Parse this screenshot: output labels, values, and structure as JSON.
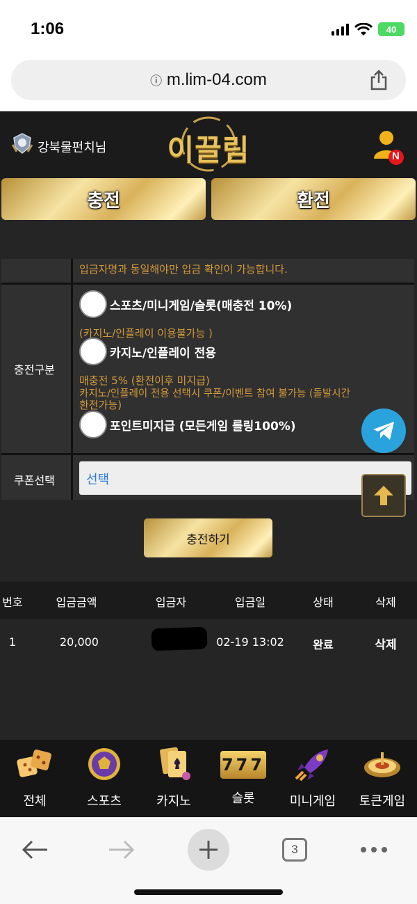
{
  "status_bar": {
    "time": "1:06",
    "battery": "40"
  },
  "browser": {
    "url": "m.lim-04.com",
    "tab_count": "3"
  },
  "header": {
    "username": "강북물펀치님",
    "logo_text": "이끌림",
    "notification_badge": "N"
  },
  "tabs": {
    "charge": "충전",
    "exchange": "환전"
  },
  "form": {
    "top_note": "입금자명과 동일해야만 입금 확인이 가능합니다.",
    "charge_type_label": "충전구분",
    "options": [
      {
        "label": "스포츠/미니게임/슬롯(매충전 10%)",
        "note": "(카지노/인플레이 이용불가능 )"
      },
      {
        "label": "카지노/인플레이 전용",
        "note_lines": [
          "매충전 5% (환전이후 미지급)",
          "카지노/인플레이 전용 선택시 쿠폰/이벤트 참여 불가능 (돌발시간",
          "환전가능)"
        ]
      },
      {
        "label": "포인트미지급 (모든게임 롤링100%)"
      }
    ],
    "coupon_label": "쿠폰선택",
    "coupon_value": "선택",
    "submit_label": "충전하기"
  },
  "table": {
    "headers": [
      "번호",
      "입금금액",
      "입금자",
      "입금일",
      "상태",
      "삭제"
    ],
    "rows": [
      {
        "no": "1",
        "amount": "20,000",
        "depositor": "",
        "date": "02-19 13:02",
        "status": "완료",
        "delete": "삭제"
      }
    ]
  },
  "games": [
    "전체",
    "스포츠",
    "카지노",
    "슬롯",
    "미니게임",
    "토큰게임"
  ],
  "slot_icon_text": "777",
  "colors": {
    "gold": "#d9b25b",
    "note": "#d39a3a",
    "bg": "#252525",
    "telegram": "#2aa3dd"
  }
}
